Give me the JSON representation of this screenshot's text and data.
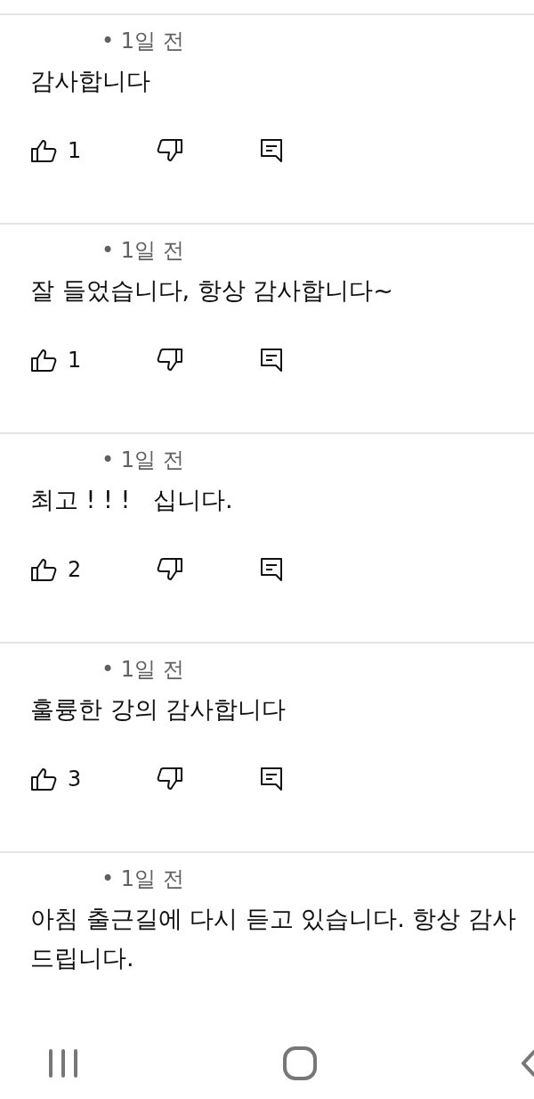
{
  "comments": [
    {
      "time": "• 1일 전",
      "text": "감사합니다",
      "likes": "1",
      "kind": "full"
    },
    {
      "time": "• 1일 전",
      "text": "잘 들었습니다, 항상 감사합니다~",
      "likes": "1",
      "kind": "full"
    },
    {
      "time": "• 1일 전",
      "text": "최고 ! ! !   십니다.",
      "likes": "2",
      "kind": "full"
    },
    {
      "time": "• 1일 전",
      "text": "훌륭한 강의 감사합니다",
      "likes": "3",
      "kind": "full"
    },
    {
      "time": "• 1일 전",
      "text": "아침 출근길에 다시 듣고 있습니다. 항상 감사드립니다.",
      "kind": "partial"
    }
  ]
}
